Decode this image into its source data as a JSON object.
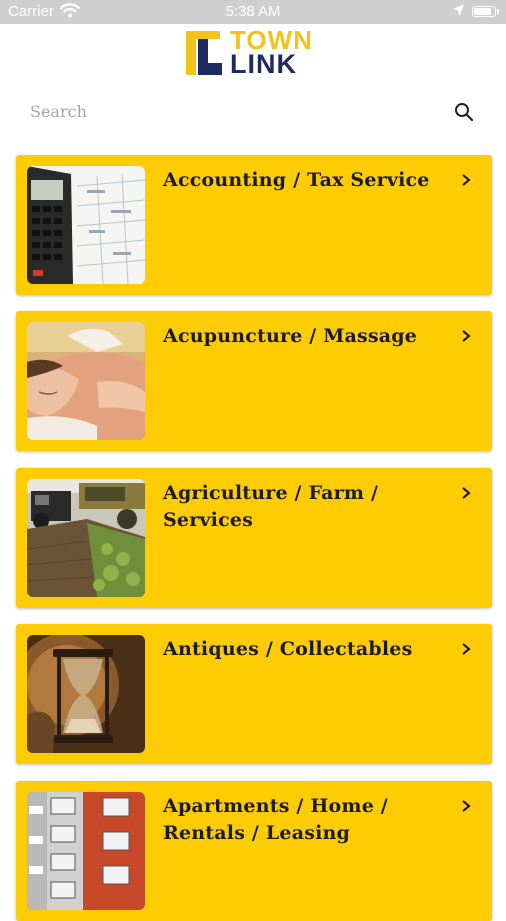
{
  "status_bar": {
    "carrier": "Carrier",
    "time": "5:38 AM",
    "battery_level": 0.9
  },
  "logo": {
    "line1": "TOWN",
    "line2": "LINK"
  },
  "search": {
    "placeholder": "Search"
  },
  "categories": [
    {
      "title": "Accounting / Tax Service",
      "image": "calculator-photo"
    },
    {
      "title": "Acupuncture / Massage",
      "image": "massage-photo"
    },
    {
      "title": "Agriculture / Farm / Services",
      "image": "farm-field-photo"
    },
    {
      "title": "Antiques / Collectables",
      "image": "hourglass-photo"
    },
    {
      "title": "Apartments / Home / Rentals / Leasing",
      "image": "apartment-building-photo"
    }
  ],
  "colors": {
    "card_bg": "#fdcc02",
    "logo_gold": "#f3c21c",
    "logo_navy": "#1f2b5e",
    "status_bar": "#cfcfcf"
  }
}
